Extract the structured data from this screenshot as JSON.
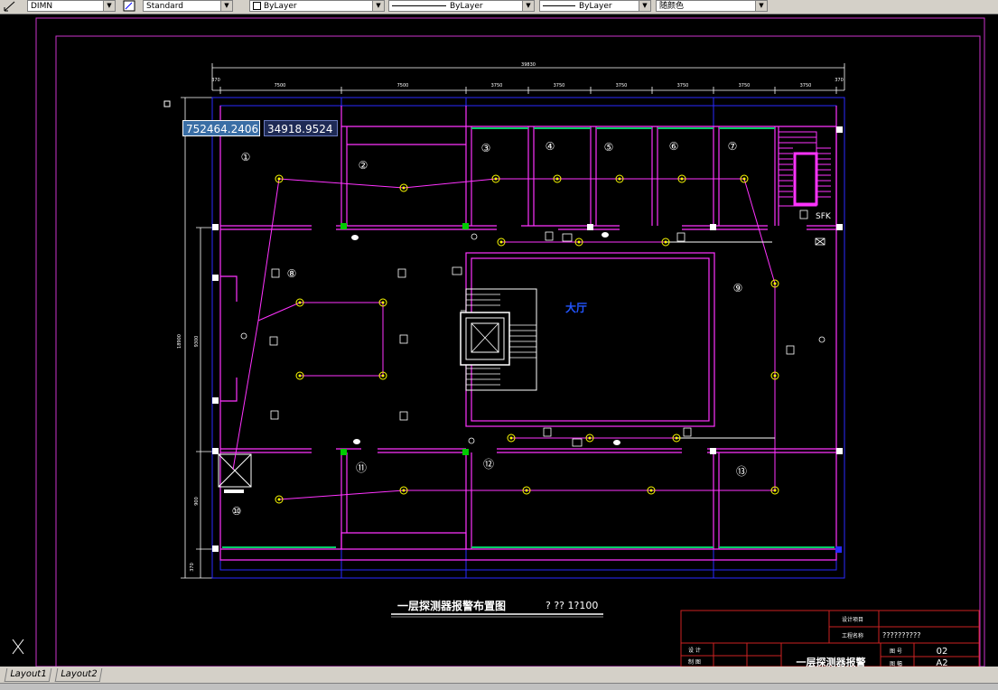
{
  "toolbar": {
    "dimstyle": "DIMN",
    "textstyle": "Standard",
    "layer": "ByLayer",
    "linetype": "ByLayer",
    "lineweight": "ByLayer",
    "color": "随颜色"
  },
  "drawing": {
    "coord_x": "752464.2406",
    "coord_y": "34918.9524",
    "hall_label": "大厅",
    "dims_top": [
      "39830",
      "370",
      "7500",
      "7500",
      "3750",
      "3750",
      "3750",
      "3750",
      "3750",
      "3750",
      "370"
    ],
    "dims_left": [
      "18900",
      "9300",
      "8100",
      "900",
      "370"
    ],
    "room_numbers": [
      "①",
      "②",
      "③",
      "④",
      "⑤",
      "⑥",
      "⑦",
      "⑧",
      "⑨",
      "⑩",
      "⑪",
      "⑫",
      "⑬"
    ],
    "sfk_label": "SFK",
    "drawing_title": "一层探测器报警布置图",
    "scale_text": "? ?? 1?100"
  },
  "titleblock": {
    "project_label": "设计项目",
    "name_label": "工程名称",
    "name_value": "??????????",
    "designer_label": "设 计",
    "drafter_label": "制 图",
    "title": "一层探测器报警",
    "sheet_no_label": "图 号",
    "sheet_no": "02",
    "size_label": "图 幅",
    "size": "A2"
  },
  "tabs": {
    "layout1": "Layout1",
    "layout2": "Layout2"
  },
  "colors": {
    "background": "#000000",
    "walls": "#ff33ff",
    "outline": "#2a2aff",
    "frame": "#cc33cc",
    "titleblock": "#cc2222",
    "dims": "#ffffff",
    "text": "#ffffff",
    "detector": "#ffff00",
    "cable": "#ff33ff",
    "junction": "#00cc00"
  }
}
